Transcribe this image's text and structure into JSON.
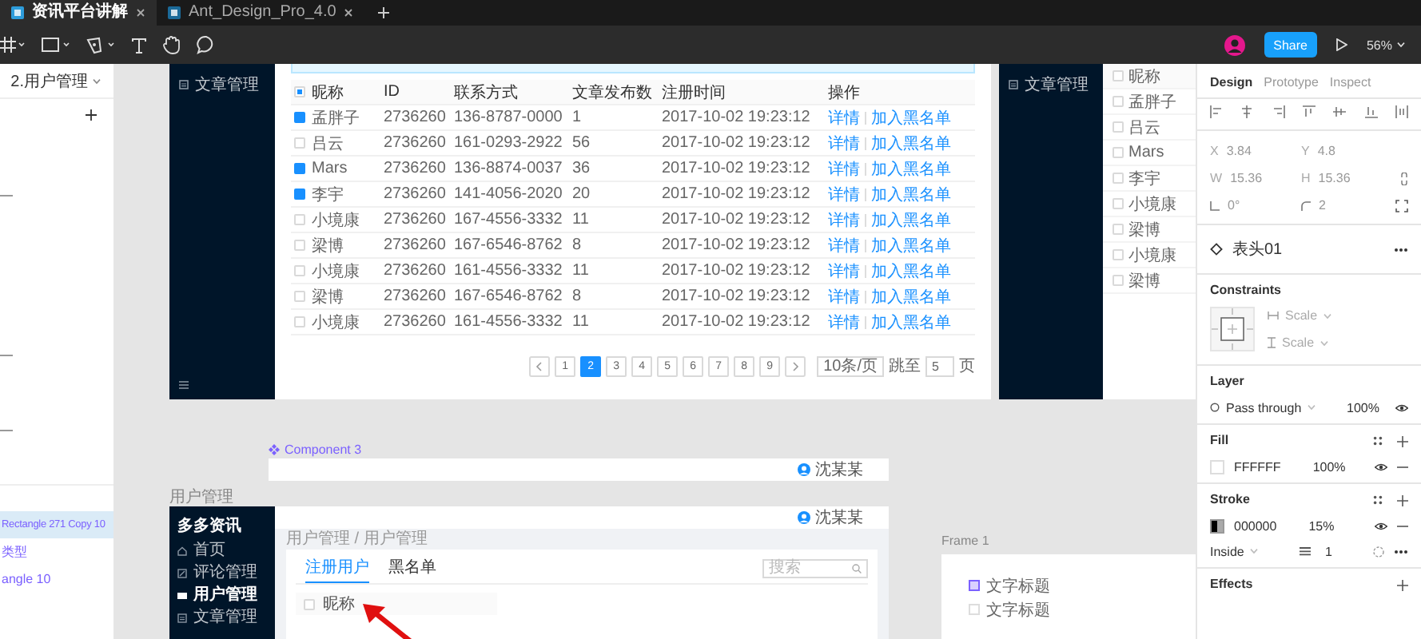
{
  "app_tabs": [
    {
      "label": "资讯平台讲解",
      "selected": true
    },
    {
      "label": "Ant_Design_Pro_4.0",
      "selected": false
    }
  ],
  "toolbar": {
    "share": "Share",
    "zoom": "56%"
  },
  "layers_panel": {
    "page": "2.用户管理",
    "layers": [
      {
        "label": "Rectangle 271 Copy 10",
        "selected": true
      },
      {
        "label": "类型",
        "selected": false
      },
      {
        "label": "angle 10",
        "selected": false
      }
    ]
  },
  "table_frame": {
    "sidebar_item": "文章管理",
    "select_all_partial": true,
    "columns": [
      "昵称",
      "ID",
      "联系方式",
      "文章发布数",
      "注册时间",
      "操作"
    ],
    "rows": [
      {
        "checked": true,
        "cells": [
          "孟胖子",
          "2736260",
          "136-8787-0000",
          "1",
          "2017-10-02  19:23:12"
        ],
        "actions": [
          "详情",
          "加入黑名单"
        ]
      },
      {
        "checked": false,
        "cells": [
          "吕云",
          "2736260",
          "161-0293-2922",
          "56",
          "2017-10-02  19:23:12"
        ],
        "actions": [
          "详情",
          "加入黑名单"
        ]
      },
      {
        "checked": true,
        "cells": [
          "Mars",
          "2736260",
          "136-8874-0037",
          "36",
          "2017-10-02  19:23:12"
        ],
        "actions": [
          "详情",
          "加入黑名单"
        ]
      },
      {
        "checked": true,
        "cells": [
          "李宇",
          "2736260",
          "141-4056-2020",
          "20",
          "2017-10-02  19:23:12"
        ],
        "actions": [
          "详情",
          "加入黑名单"
        ]
      },
      {
        "checked": false,
        "cells": [
          "小境康",
          "2736260",
          "167-4556-3332",
          "11",
          "2017-10-02  19:23:12"
        ],
        "actions": [
          "详情",
          "加入黑名单"
        ]
      },
      {
        "checked": false,
        "cells": [
          "梁博",
          "2736260",
          "167-6546-8762",
          "8",
          "2017-10-02  19:23:12"
        ],
        "actions": [
          "详情",
          "加入黑名单"
        ]
      },
      {
        "checked": false,
        "cells": [
          "小境康",
          "2736260",
          "161-4556-3332",
          "11",
          "2017-10-02  19:23:12"
        ],
        "actions": [
          "详情",
          "加入黑名单"
        ]
      },
      {
        "checked": false,
        "cells": [
          "梁博",
          "2736260",
          "167-6546-8762",
          "8",
          "2017-10-02  19:23:12"
        ],
        "actions": [
          "详情",
          "加入黑名单"
        ]
      },
      {
        "checked": false,
        "cells": [
          "小境康",
          "2736260",
          "161-4556-3332",
          "11",
          "2017-10-02  19:23:12"
        ],
        "actions": [
          "详情",
          "加入黑名单"
        ]
      }
    ],
    "pagination": {
      "pages": [
        {
          "label": "1",
          "selected": false
        },
        {
          "label": "2",
          "selected": true
        },
        {
          "label": "3",
          "selected": false
        },
        {
          "label": "4",
          "selected": false
        },
        {
          "label": "5",
          "selected": false
        },
        {
          "label": "6",
          "selected": false
        },
        {
          "label": "7",
          "selected": false
        },
        {
          "label": "8",
          "selected": false
        },
        {
          "label": "9",
          "selected": false
        }
      ],
      "page_size": "10条/页",
      "jump_label": "跳至",
      "jump_value": "5",
      "page_suffix": "页"
    }
  },
  "list_frame": {
    "sidebar_item": "文章管理",
    "header": "昵称",
    "header_checked": false,
    "items": [
      {
        "label": "孟胖子",
        "checked": false
      },
      {
        "label": "吕云",
        "checked": false
      },
      {
        "label": "Mars",
        "checked": false
      },
      {
        "label": "李宇",
        "checked": false
      },
      {
        "label": "小境康",
        "checked": false
      },
      {
        "label": "梁博",
        "checked": false
      },
      {
        "label": "小境康",
        "checked": false
      },
      {
        "label": "梁博",
        "checked": false
      }
    ]
  },
  "component": {
    "title": "Component 3",
    "user": "沈某某"
  },
  "user_frame": {
    "label": "用户管理",
    "brand": "多多资讯",
    "nav": [
      {
        "label": "首页",
        "selected": false
      },
      {
        "label": "评论管理",
        "selected": false
      },
      {
        "label": "用户管理",
        "selected": true
      },
      {
        "label": "文章管理",
        "selected": false
      }
    ],
    "user": "沈某某",
    "breadcrumb": "用户管理 / 用户管理",
    "tabs": [
      {
        "label": "注册用户",
        "selected": true
      },
      {
        "label": "黑名单",
        "selected": false
      }
    ],
    "search": {
      "placeholder": "搜索"
    },
    "header": "昵称",
    "header_checked": false
  },
  "frame_1": {
    "label": "Frame 1",
    "items": [
      {
        "label": "文字标题",
        "selected": true
      },
      {
        "label": "文字标题",
        "selected": false
      }
    ]
  },
  "design_panel": {
    "tabs": [
      {
        "label": "Design",
        "selected": true
      },
      {
        "label": "Prototype",
        "selected": false
      },
      {
        "label": "Inspect",
        "selected": false
      }
    ],
    "geometry": [
      {
        "kind": "label",
        "label": "X",
        "value": "3.84"
      },
      {
        "kind": "label",
        "label": "Y",
        "value": "4.8"
      },
      {
        "kind": "label",
        "label": "W",
        "value": "15.36"
      },
      {
        "kind": "label",
        "label": "H",
        "value": "15.36"
      },
      {
        "kind": "angle",
        "value": "0°"
      },
      {
        "kind": "radius",
        "value": "2"
      }
    ],
    "component": "表头01",
    "constraints": {
      "title": "Constraints",
      "horizontal": "Scale",
      "vertical": "Scale"
    },
    "layer": {
      "title": "Layer",
      "blend": "Pass through",
      "opacity": "100%"
    },
    "fill": {
      "title": "Fill",
      "color": "FFFFFF",
      "opacity": "100%"
    },
    "stroke": {
      "title": "Stroke",
      "color": "000000",
      "opacity": "15%",
      "position": "Inside",
      "weight": "1"
    },
    "effects": {
      "title": "Effects"
    }
  }
}
